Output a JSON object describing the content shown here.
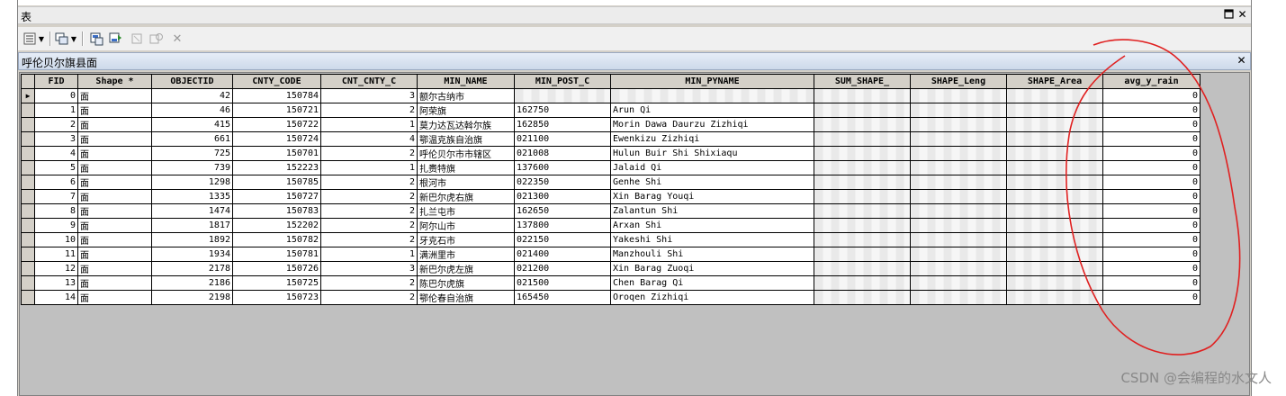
{
  "window": {
    "title": "表",
    "tab_title": "呼伦贝尔旗县面"
  },
  "icons": [
    "table-options-icon",
    "dropdown-arrow-icon",
    "related-tables-icon",
    "select-by-attributes-icon",
    "switch-selection-icon",
    "clear-selection-icon",
    "zoom-to-selected-icon",
    "delete-selected-icon"
  ],
  "columns": [
    "FID",
    "Shape *",
    "OBJECTID",
    "CNTY_CODE",
    "CNT_CNTY_C",
    "MIN_NAME",
    "MIN_POST_C",
    "MIN_PYNAME",
    "SUM_SHAPE_",
    "SHAPE_Leng",
    "SHAPE_Area",
    "avg_y_rain"
  ],
  "rows": [
    [
      "0",
      "面",
      "42",
      "150784",
      "3",
      "额尔古纳市",
      "",
      "",
      "",
      "",
      "",
      "0"
    ],
    [
      "1",
      "面",
      "46",
      "150721",
      "2",
      "阿荣旗",
      "162750",
      "Arun Qi",
      "",
      "",
      "",
      "0"
    ],
    [
      "2",
      "面",
      "415",
      "150722",
      "1",
      "莫力达瓦达斡尔族",
      "162850",
      "Morin Dawa Daurzu Zizhiqi",
      "",
      "",
      "",
      "0"
    ],
    [
      "3",
      "面",
      "661",
      "150724",
      "4",
      "鄂温克族自治旗",
      "021100",
      "Ewenkizu Zizhiqi",
      "",
      "",
      "",
      "0"
    ],
    [
      "4",
      "面",
      "725",
      "150701",
      "2",
      "呼伦贝尔市市辖区",
      "021008",
      "Hulun Buir Shi Shixiaqu",
      "",
      "",
      "",
      "0"
    ],
    [
      "5",
      "面",
      "739",
      "152223",
      "1",
      "扎赉特旗",
      "137600",
      "Jalaid Qi",
      "",
      "",
      "",
      "0"
    ],
    [
      "6",
      "面",
      "1298",
      "150785",
      "2",
      "根河市",
      "022350",
      "Genhe Shi",
      "",
      "",
      "",
      "0"
    ],
    [
      "7",
      "面",
      "1335",
      "150727",
      "2",
      "新巴尔虎右旗",
      "021300",
      "Xin Barag Youqi",
      "",
      "",
      "",
      "0"
    ],
    [
      "8",
      "面",
      "1474",
      "150783",
      "2",
      "扎兰屯市",
      "162650",
      "Zalantun Shi",
      "",
      "",
      "",
      "0"
    ],
    [
      "9",
      "面",
      "1817",
      "152202",
      "2",
      "阿尔山市",
      "137800",
      "Arxan Shi",
      "",
      "",
      "",
      "0"
    ],
    [
      "10",
      "面",
      "1892",
      "150782",
      "2",
      "牙克石市",
      "022150",
      "Yakeshi Shi",
      "",
      "",
      "",
      "0"
    ],
    [
      "11",
      "面",
      "1934",
      "150781",
      "1",
      "满洲里市",
      "021400",
      "Manzhouli Shi",
      "",
      "",
      "",
      "0"
    ],
    [
      "12",
      "面",
      "2178",
      "150726",
      "3",
      "新巴尔虎左旗",
      "021200",
      "Xin Barag Zuoqi",
      "",
      "",
      "",
      "0"
    ],
    [
      "13",
      "面",
      "2186",
      "150725",
      "2",
      "陈巴尔虎旗",
      "021500",
      "Chen Barag Qi",
      "",
      "",
      "",
      "0"
    ],
    [
      "14",
      "面",
      "2198",
      "150723",
      "2",
      "鄂伦春自治旗",
      "165450",
      "Oroqen Zizhiqi",
      "",
      "",
      "",
      "0"
    ]
  ],
  "watermark": "CSDN @会编程的水文人",
  "colors": {
    "annotation": "#e02020",
    "header_bg": "#d4d0c8"
  }
}
